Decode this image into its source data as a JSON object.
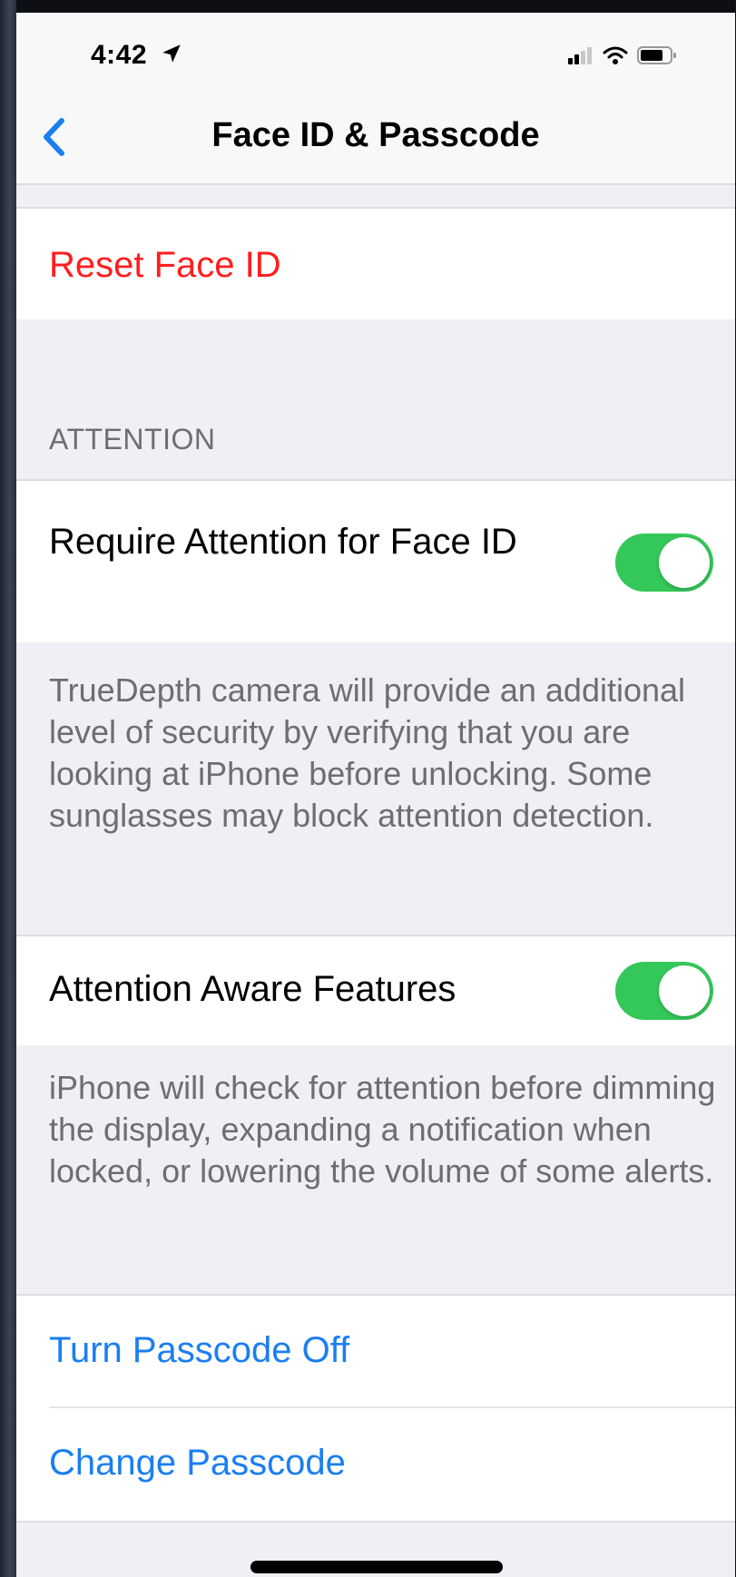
{
  "status_bar": {
    "time": "4:42",
    "location_icon": "location-arrow-icon",
    "signal_icon": "cellular-signal-icon",
    "wifi_icon": "wifi-icon",
    "battery_icon": "battery-icon"
  },
  "nav": {
    "title": "Face ID & Passcode",
    "back_icon": "chevron-left-icon"
  },
  "reset": {
    "label": "Reset Face ID"
  },
  "attention_section": {
    "header": "ATTENTION",
    "require_attention": {
      "label": "Require Attention for Face ID",
      "enabled": true
    },
    "require_attention_footer": "TrueDepth camera will provide an additional level of security by verifying that you are looking at iPhone before unlocking. Some sunglasses may block attention detection.",
    "aware_features": {
      "label": "Attention Aware Features",
      "enabled": true
    },
    "aware_features_footer": "iPhone will check for attention before dimming the display, expanding a notification when locked, or lowering the volume of some alerts."
  },
  "passcode": {
    "turn_off_label": "Turn Passcode Off",
    "change_label": "Change Passcode"
  },
  "colors": {
    "destructive": "#ff1e1e",
    "link": "#1a7ef2",
    "toggle_on": "#34c759",
    "background": "#efeff4"
  }
}
